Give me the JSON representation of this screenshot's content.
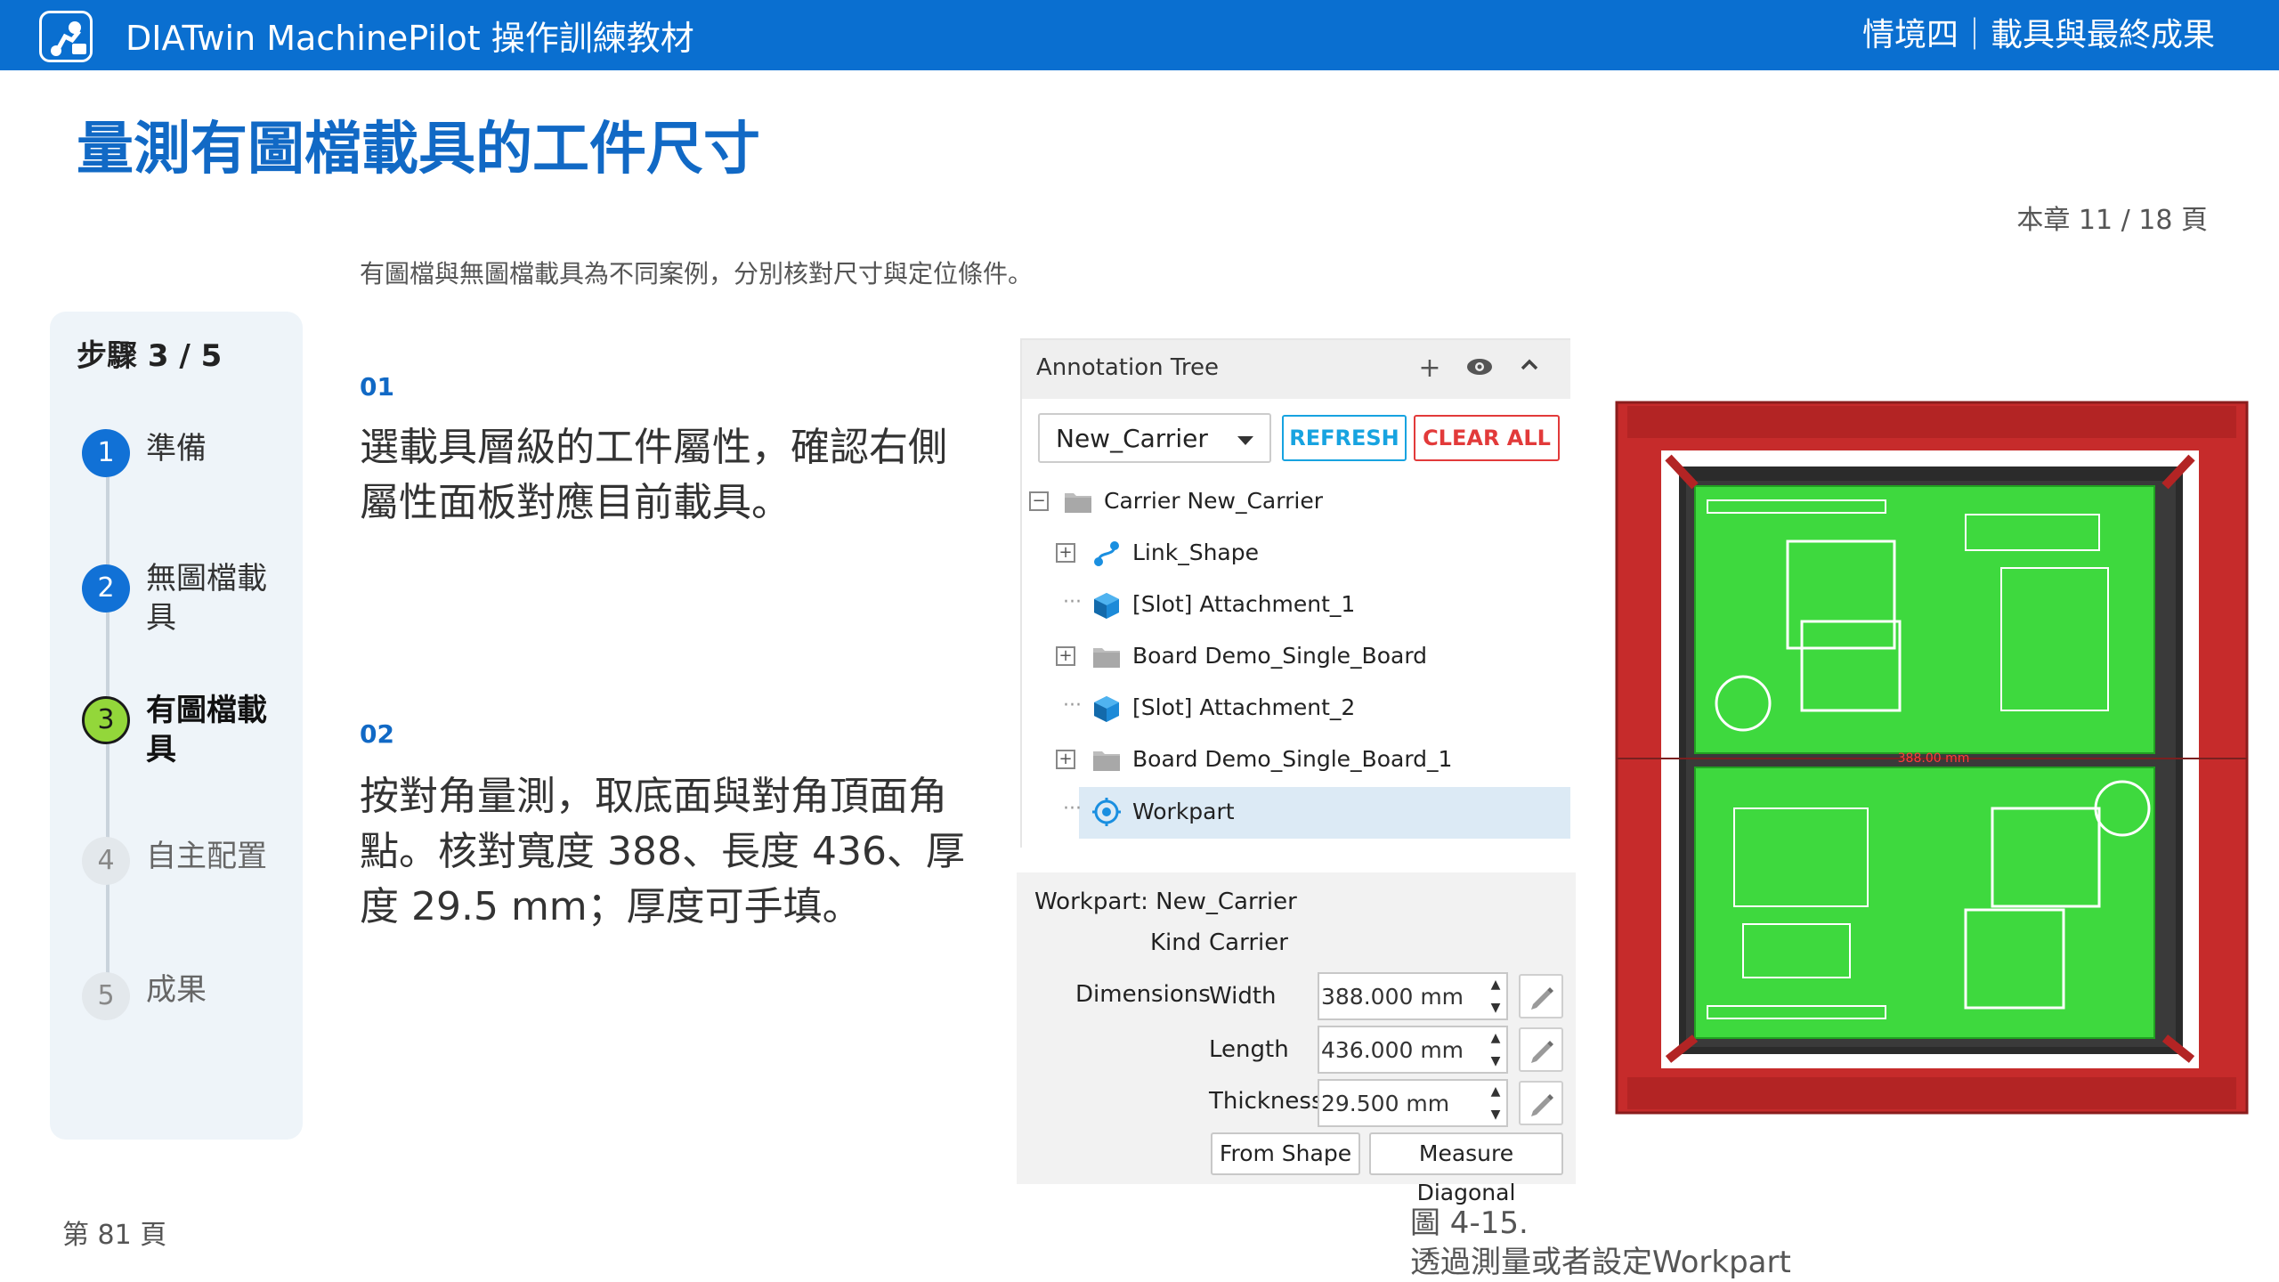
{
  "header": {
    "app_title": "DIATwin MachinePilot 操作訓練教材",
    "chapter_title": "情境四｜載具與最終成果"
  },
  "page": {
    "title": "量測有圖檔載具的工件尺寸",
    "chapter_page": "本章 11 / 18 頁",
    "subtitle": "有圖檔與無圖檔載具為不同案例，分別核對尺寸與定位條件。",
    "page_number": "第 81 頁",
    "figure_caption_line1": "圖 4-15.",
    "figure_caption_line2": "透過測量或者設定Workpart"
  },
  "steps": {
    "heading": "步驟 3 / 5",
    "items": [
      {
        "num": "1",
        "label": "準備",
        "state": "done"
      },
      {
        "num": "2",
        "label": "無圖檔載具",
        "state": "done"
      },
      {
        "num": "3",
        "label": "有圖檔載具",
        "state": "current"
      },
      {
        "num": "4",
        "label": "自主配置",
        "state": "todo"
      },
      {
        "num": "5",
        "label": "成果",
        "state": "todo"
      }
    ]
  },
  "content": {
    "step1_num": "01",
    "step1_text": "選載具層級的工件屬性，確認右側屬性面板對應目前載具。",
    "step2_num": "02",
    "step2_text": "按對角量測，取底面與對角頂面角點。核對寬度 388、長度 436、厚度 29.5 mm；厚度可手填。"
  },
  "annotation_tree": {
    "title": "Annotation Tree",
    "header_icons": [
      "plus-icon",
      "eye-icon",
      "chevron-up-icon"
    ],
    "selected_carrier": "New_Carrier",
    "refresh_label": "REFRESH",
    "clear_all_label": "CLEAR ALL",
    "rows": [
      {
        "label": "Carrier  New_Carrier",
        "icon": "folder-icon",
        "expander": "−",
        "indent": 0
      },
      {
        "label": "Link_Shape",
        "icon": "link-shape-icon",
        "expander": "+",
        "indent": 1
      },
      {
        "label": "[Slot] Attachment_1",
        "icon": "cube-icon",
        "expander": "",
        "indent": 1
      },
      {
        "label": "Board  Demo_Single_Board",
        "icon": "folder-icon",
        "expander": "+",
        "indent": 1
      },
      {
        "label": "[Slot] Attachment_2",
        "icon": "cube-icon",
        "expander": "",
        "indent": 1
      },
      {
        "label": "Board  Demo_Single_Board_1",
        "icon": "folder-icon",
        "expander": "+",
        "indent": 1
      },
      {
        "label": "Workpart",
        "icon": "workpart-icon",
        "expander": "",
        "indent": 1
      }
    ]
  },
  "properties": {
    "workpart_label": "Workpart: New_Carrier",
    "kind_label": "Kind",
    "kind_value": "Carrier",
    "dimensions_label": "Dimensions",
    "width_label": "Width",
    "width_value": "388.000 mm",
    "length_label": "Length",
    "length_value": "436.000 mm",
    "thickness_label": "Thickness",
    "thickness_value": "29.500 mm",
    "from_shape_label": "From Shape",
    "measure_diagonal_label": "Measure Diagonal"
  },
  "figure": {
    "measure_label": "388.00 mm",
    "colors": {
      "frame": "#c62b2b",
      "pcb": "#3ed93e",
      "tray": "#2b2b2b"
    }
  }
}
